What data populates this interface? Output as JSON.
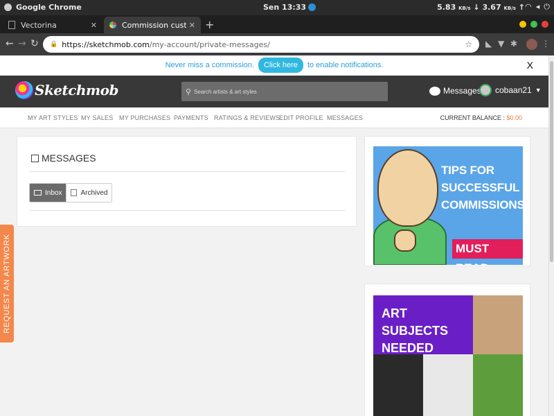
{
  "os": {
    "app_name": "Google Chrome",
    "clock": "Sen 13:33",
    "net_down": "5.83",
    "net_down_unit": "KB/s",
    "net_up": "3.67",
    "net_up_unit": "KB/s"
  },
  "browser": {
    "tabs": [
      {
        "title": "Vectorina",
        "active": false
      },
      {
        "title": "Commission custom art, g",
        "active": true
      }
    ],
    "url_host": "https://sketchmob.com",
    "url_path": "/my-account/private-messages/"
  },
  "notification": {
    "prefix": "Never miss a commission.",
    "cta": "Click here",
    "suffix": "to enable notifications.",
    "close": "X"
  },
  "header": {
    "logo_text": "Sketchmob",
    "search_placeholder": "Search artists & art styles",
    "messages_label": "Messages",
    "username": "cobaan21"
  },
  "subnav": {
    "items": [
      "MY ART STYLES",
      "MY SALES",
      "MY PURCHASES",
      "PAYMENTS",
      "RATINGS & REVIEWS",
      "EDIT PROFILE",
      "MESSAGES"
    ],
    "balance_label": "CURRENT BALANCE :",
    "balance_value": "$0.00"
  },
  "messages": {
    "title": "MESSAGES",
    "tabs": [
      "Inbox",
      "Archived"
    ],
    "active_tab": "Inbox"
  },
  "ads": {
    "tips_line1": "TIPS FOR",
    "tips_line2": "SUCCESSFUL",
    "tips_line3": "COMMISSIONS",
    "must_read": "MUST READ",
    "subjects_line1": "ART SUBJECTS",
    "subjects_line2": "NEEDED"
  },
  "side_tab": "REQUEST AN ARTWORK",
  "colors": {
    "accent_blue": "#2fb8e0",
    "header_dark": "#383838",
    "side_tab": "#f4874b",
    "balance": "#e87b3a"
  }
}
